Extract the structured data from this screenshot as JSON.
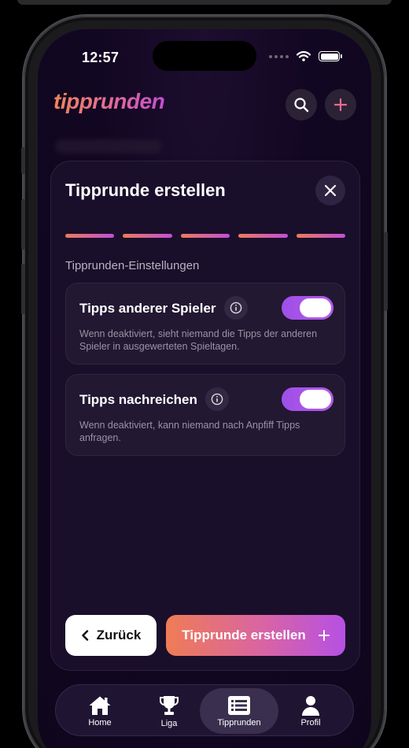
{
  "status_bar": {
    "time": "12:57"
  },
  "app": {
    "logo": "tipprunden"
  },
  "header": {
    "search_icon": "search-icon",
    "add_icon": "plus-icon"
  },
  "modal": {
    "title": "Tipprunde erstellen",
    "close_icon": "close-icon",
    "progress_steps_total": 5,
    "progress_steps_completed": 5,
    "section_label": "Tipprunden-Einstellungen",
    "settings": [
      {
        "title": "Tipps anderer Spieler",
        "description": "Wenn deaktiviert, sieht niemand die Tipps der anderen Spieler in ausgewerteten Spieltagen.",
        "enabled": true
      },
      {
        "title": "Tipps nachreichen",
        "description": "Wenn deaktiviert, kann niemand nach Anpfiff Tipps anfragen.",
        "enabled": true
      }
    ],
    "back_label": "Zurück",
    "create_label": "Tipprunde erstellen"
  },
  "tabbar": {
    "items": [
      {
        "label": "Home",
        "icon": "home-icon"
      },
      {
        "label": "Liga",
        "icon": "trophy-icon"
      },
      {
        "label": "Tipprunden",
        "icon": "list-icon",
        "active": true
      },
      {
        "label": "Profil",
        "icon": "person-icon"
      }
    ]
  },
  "colors": {
    "accent_orange": "#ef7c55",
    "accent_purple": "#b650e4",
    "background": "#120722"
  }
}
